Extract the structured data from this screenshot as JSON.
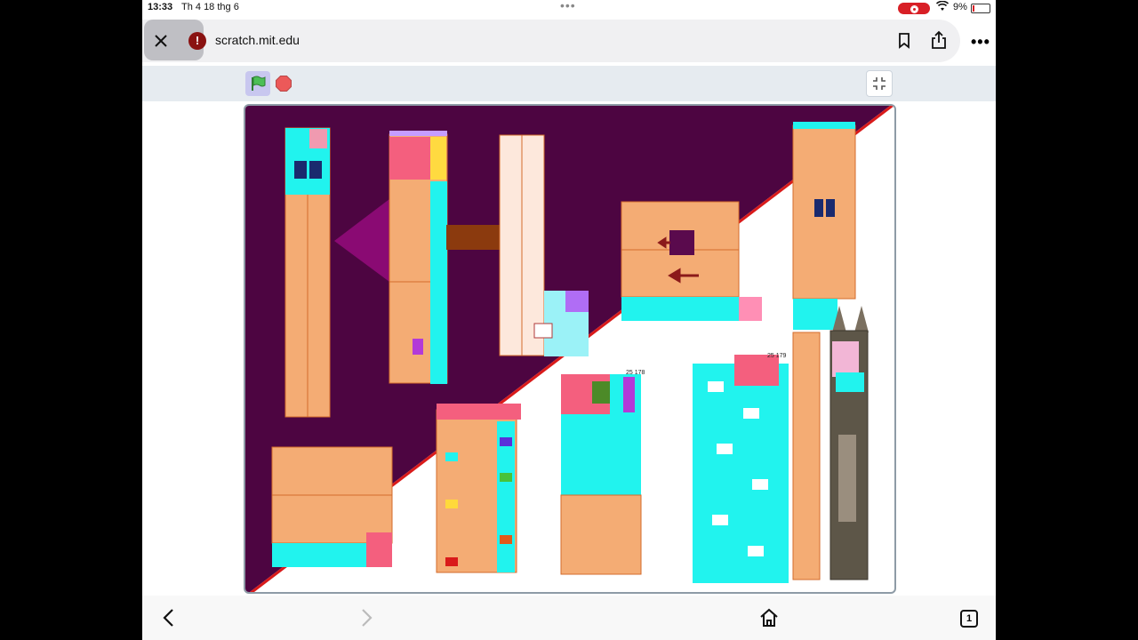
{
  "status": {
    "time": "13:33",
    "date": "Th 4 18 thg 6",
    "battery": "9%"
  },
  "browser": {
    "url": "scratch.mit.edu",
    "tab_count": "1"
  },
  "stage": {
    "labels": {
      "a": "25 178",
      "b": "25 179"
    },
    "colors": {
      "purple": "#4d0541",
      "peach": "#f4ac74",
      "cyan": "#21f3ee",
      "red": "#d91a1a"
    }
  }
}
